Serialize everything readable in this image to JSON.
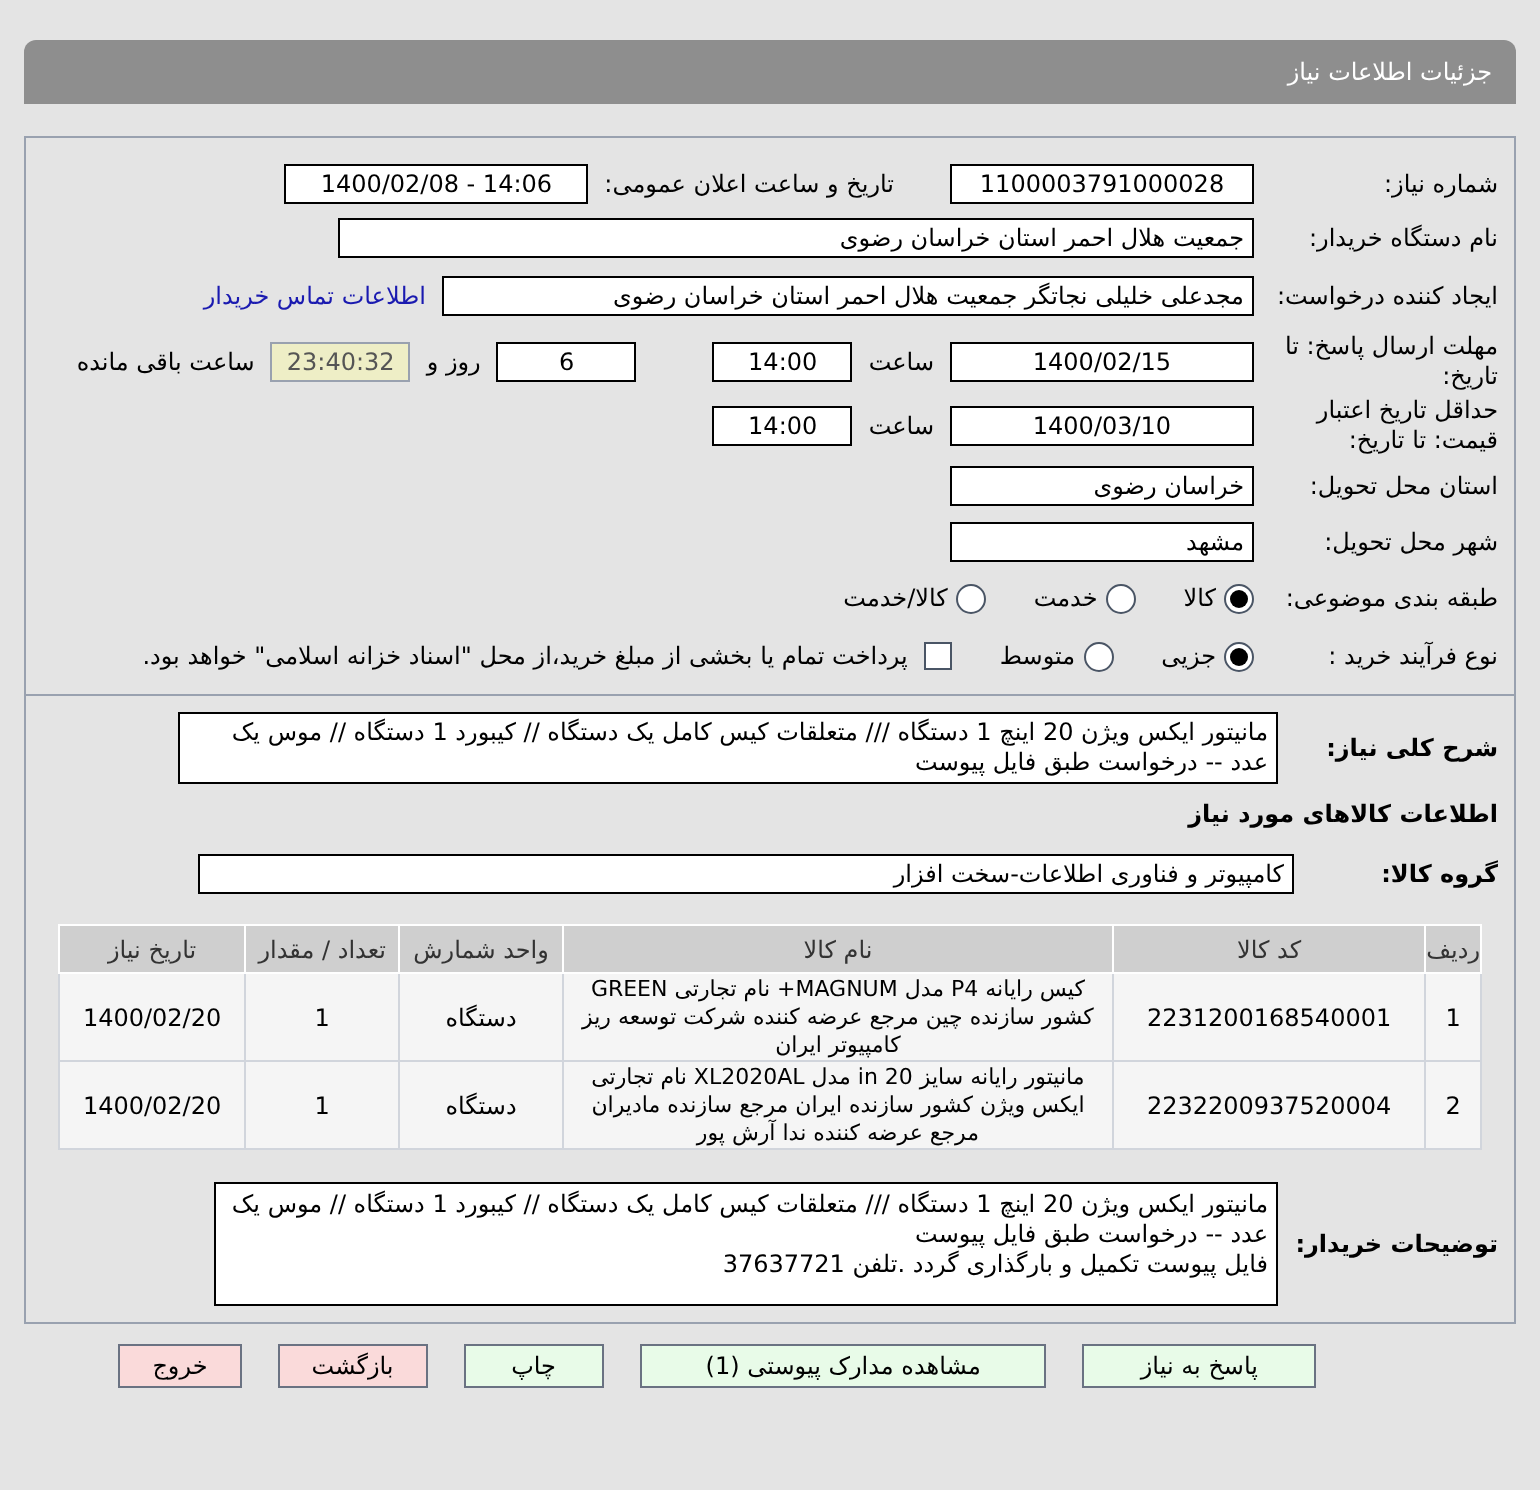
{
  "header": {
    "title": "جزئیات اطلاعات نیاز"
  },
  "need_number": {
    "label": "شماره نیاز:",
    "value": "1100003791000028"
  },
  "announce": {
    "label": "تاریخ و ساعت اعلان عمومی:",
    "value": "1400/02/08 - 14:06"
  },
  "buyer_org": {
    "label": "نام دستگاه خریدار:",
    "value": "جمعیت هلال احمر استان خراسان رضوی"
  },
  "creator": {
    "label": "ایجاد کننده درخواست:",
    "value": "مجدعلی خلیلی نجاتگر جمعیت هلال احمر استان خراسان رضوی",
    "link": "اطلاعات تماس خریدار"
  },
  "deadline": {
    "label": "مهلت ارسال پاسخ: تا تاریخ:",
    "date": "1400/02/15",
    "time_label": "ساعت",
    "time": "14:00",
    "days": "6",
    "days_label": "روز و",
    "remaining": "23:40:32",
    "remaining_label": "ساعت باقی مانده"
  },
  "validity": {
    "label": "حداقل تاریخ اعتبار قیمت: تا تاریخ:",
    "date": "1400/03/10",
    "time_label": "ساعت",
    "time": "14:00"
  },
  "province": {
    "label": "استان محل تحویل:",
    "value": "خراسان رضوی"
  },
  "city": {
    "label": "شهر محل تحویل:",
    "value": "مشهد"
  },
  "category": {
    "label": "طبقه بندی موضوعی:",
    "options": [
      {
        "label": "کالا",
        "selected": true
      },
      {
        "label": "خدمت",
        "selected": false
      },
      {
        "label": "کالا/خدمت",
        "selected": false
      }
    ]
  },
  "process": {
    "label": "نوع فرآیند خرید :",
    "options": [
      {
        "label": "جزیی",
        "selected": true
      },
      {
        "label": "متوسط",
        "selected": false
      }
    ],
    "payment": {
      "label": "پرداخت تمام یا بخشی از مبلغ خرید،از محل \"اسناد خزانه اسلامی\" خواهد بود.",
      "checked": false
    }
  },
  "summary": {
    "label": "شرح کلی نیاز:",
    "value": "مانیتور ایکس ویژن 20 اینچ 1 دستگاه /// متعلقات کیس کامل یک دستگاه // کیبورد 1 دستگاه // موس یک عدد -- درخواست طبق فایل پیوست"
  },
  "goods_heading": "اطلاعات کالاهای مورد نیاز",
  "goods_group": {
    "label": "گروه کالا:",
    "value": "کامپیوتر و فناوری اطلاعات-سخت افزار"
  },
  "table": {
    "columns": [
      "ردیف",
      "کد کالا",
      "نام کالا",
      "واحد شمارش",
      "تعداد / مقدار",
      "تاریخ نیاز"
    ],
    "rows": [
      [
        "1",
        "2231200168540001",
        "کیس رایانه P4 مدل MAGNUM+ نام تجارتی GREEN کشور سازنده چین مرجع عرضه کننده شرکت توسعه ریز کامپیوتر ایران",
        "دستگاه",
        "1",
        "1400/02/20"
      ],
      [
        "2",
        "2232200937520004",
        "مانیتور رایانه سایز 20 in مدل XL2020AL نام تجارتی ایکس ویژن کشور سازنده ایران مرجع سازنده مادیران مرجع عرضه کننده ندا آرش پور",
        "دستگاه",
        "1",
        "1400/02/20"
      ]
    ]
  },
  "buyer_notes": {
    "label": "توضیحات خریدار:",
    "lines": [
      "مانیتور ایکس ویژن 20 اینچ 1 دستگاه /// متعلقات کیس کامل یک دستگاه // کیبورد 1 دستگاه // موس یک عدد -- درخواست طبق فایل پیوست",
      "فایل پیوست تکمیل  و بارگذاری گردد .تلفن 37637721"
    ]
  },
  "buttons": [
    {
      "label": "پاسخ به نیاز",
      "kind": "normal"
    },
    {
      "label": "مشاهده مدارک پیوستی (1)",
      "kind": "normal"
    },
    {
      "label": "چاپ",
      "kind": "normal"
    },
    {
      "label": "بازگشت",
      "kind": "danger"
    },
    {
      "label": "خروج",
      "kind": "danger"
    }
  ]
}
